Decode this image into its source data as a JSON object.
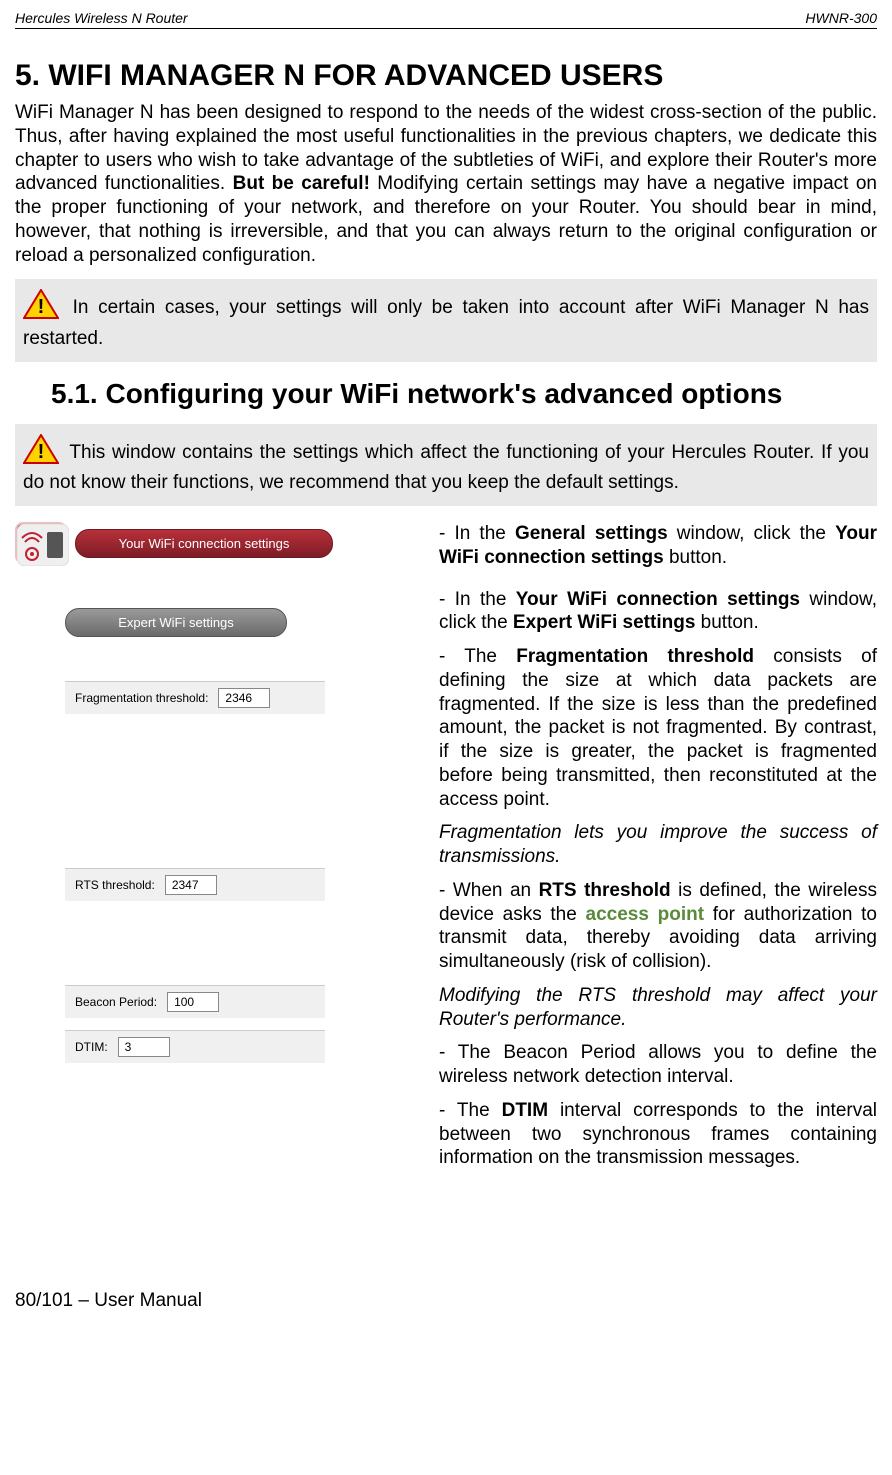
{
  "header": {
    "left": "Hercules Wireless N Router",
    "right": "HWNR-300"
  },
  "h1": "5.  WIFI MANAGER N FOR ADVANCED USERS",
  "intro": {
    "p1a": "WiFi Manager N has been designed to respond to the needs of the widest cross-section of the public.  Thus, after having explained the most useful functionalities in the previous chapters, we dedicate this chapter to users who wish to take advantage of the subtleties of WiFi, and explore their Router's more advanced functionalities.  ",
    "p1b": "But be careful!",
    "p1c": "  Modifying certain settings may have a negative impact on the proper functioning of your network, and therefore on your Router.  You should bear in mind, however, that nothing is irreversible, and that you can always return to the original configuration or reload a personalized configuration."
  },
  "notice1": " In certain cases, your settings will only be taken into account after WiFi Manager N has restarted.",
  "h2": "5.1.  Configuring your WiFi network's advanced options",
  "notice2": " This window contains the settings which affect the functioning of your Hercules Router.  If you do not know their functions, we recommend that you keep the default settings.",
  "buttons": {
    "wifi_conn": "Your WiFi connection settings",
    "expert": "Expert WiFi settings"
  },
  "fields": {
    "frag_label": "Fragmentation threshold:",
    "frag_value": "2346",
    "rts_label": "RTS threshold:",
    "rts_value": "2347",
    "beacon_label": "Beacon Period:",
    "beacon_value": "100",
    "dtim_label": "DTIM:",
    "dtim_value": "3"
  },
  "right": {
    "p1a": "- In the ",
    "p1b": "General settings",
    "p1c": " window, click the ",
    "p1d": "Your WiFi connection settings",
    "p1e": " button.",
    "p2a": "- In the ",
    "p2b": "Your WiFi connection settings",
    "p2c": "  window, click the ",
    "p2d": "Expert WiFi settings",
    "p2e": " button.",
    "p3a": "- The ",
    "p3b": "Fragmentation threshold",
    "p3c": " consists of defining the size at which data packets are fragmented.  If the size is less than the predefined amount, the packet is not fragmented.  By contrast, if the size is greater, the packet is fragmented before being transmitted, then reconstituted at the access point.",
    "p4": "Fragmentation lets you improve the success of transmissions.",
    "p5a": "- When an ",
    "p5b": "RTS threshold",
    "p5c": " is defined, the wireless device asks the ",
    "p5d": "access point",
    "p5e": " for authorization to transmit data, thereby avoiding data arriving simultaneously (risk of collision).",
    "p6": "Modifying the RTS threshold may affect your Router's performance.",
    "p7": "- The Beacon Period allows you to define the wireless network detection interval.",
    "p8a": "- The ",
    "p8b": "DTIM",
    "p8c": " interval corresponds to the interval between two synchronous frames containing information on the transmission messages."
  },
  "footer": "80/101 – User Manual"
}
